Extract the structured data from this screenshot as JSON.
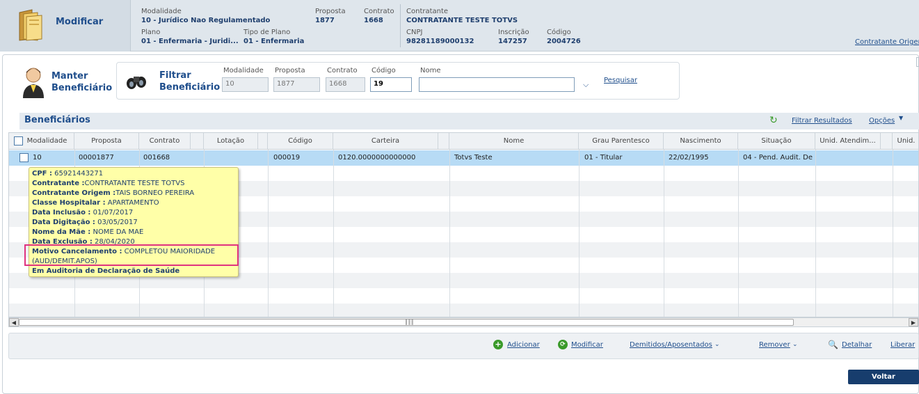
{
  "header": {
    "title": "Modificar",
    "modalidade_label": "Modalidade",
    "modalidade_value": "10 - Jurídico Nao Regulamentado",
    "proposta_label": "Proposta",
    "proposta_value": "1877",
    "contrato_label": "Contrato",
    "contrato_value": "1668",
    "plano_label": "Plano",
    "plano_value": "01 - Enfermaria - Juridi...",
    "tipo_plano_label": "Tipo de Plano",
    "tipo_plano_value": "01 - Enfermaria",
    "contratante_label": "Contratante",
    "contratante_value": "CONTRATANTE TESTE TOTVS",
    "cnpj_label": "CNPJ",
    "cnpj_value": "98281189000132",
    "inscricao_label": "Inscrição",
    "inscricao_value": "147257",
    "codigo_label": "Código",
    "codigo_value": "2004726",
    "contratante_origem_link": "Contratante Origem"
  },
  "manager": {
    "title_line1": "Manter",
    "title_line2": "Beneficiário"
  },
  "filter": {
    "title_line1": "Filtrar",
    "title_line2": "Beneficiário",
    "fields": {
      "modalidade": {
        "label": "Modalidade",
        "value": "10"
      },
      "proposta": {
        "label": "Proposta",
        "value": "1877"
      },
      "contrato": {
        "label": "Contrato",
        "value": "1668"
      },
      "codigo": {
        "label": "Código",
        "value": "19"
      },
      "nome": {
        "label": "Nome",
        "value": ""
      }
    },
    "search_link": "Pesquisar"
  },
  "section": {
    "title": "Beneficiários",
    "filter_results": "Filtrar Resultados",
    "options": "Opções"
  },
  "grid": {
    "columns": [
      "Modalidade",
      "Proposta",
      "Contrato",
      "Lotação",
      "Código",
      "Carteira",
      "Nome",
      "Grau Parentesco",
      "Nascimento",
      "Situação",
      "Unid. Atendim...",
      "Unid."
    ],
    "row": {
      "modalidade": "10",
      "proposta": "00001877",
      "contrato": "001668",
      "lotacao": "",
      "codigo": "000019",
      "carteira": "0120.0000000000000",
      "nome": "Totvs Teste",
      "grau": "01 - Titular",
      "nascimento": "22/02/1995",
      "situacao": "04 - Pend. Audit. De"
    }
  },
  "tooltip": {
    "cpf_label": "CPF :",
    "cpf_value": " 65921443271",
    "contratante_label": "Contratante :",
    "contratante_value": "CONTRATANTE TESTE TOTVS",
    "origem_label": "Contratante Origem :",
    "origem_value": "TAIS BORNEO PEREIRA",
    "classe_label": "Classe Hospitalar :",
    "classe_value": " APARTAMENTO",
    "inclusao_label": "Data Inclusão :",
    "inclusao_value": " 01/07/2017",
    "digitacao_label": "Data Digitação :",
    "digitacao_value": " 03/05/2017",
    "mae_label": "Nome da Mãe :",
    "mae_value": " NOME DA MAE",
    "exclusao_label": "Data Exclusão :",
    "exclusao_value": " 28/04/2020",
    "motivo_label": "Motivo Cancelamento :",
    "motivo_value": " COMPLETOU MAIORIDADE",
    "motivo_value2": "(AUD/DEMIT.APOS)",
    "auditoria": "Em Auditoria de Declaração de Saúde"
  },
  "actions": {
    "adicionar": "Adicionar",
    "modificar": "Modificar",
    "demitidos": "Demitidos/Aposentados",
    "remover": "Remover",
    "detalhar": "Detalhar",
    "liberar": "Liberar",
    "voltar": "Voltar"
  },
  "colors": {
    "accent": "#1f4e8c",
    "selected_row": "#b7dbf5",
    "tooltip_bg": "#ffffa8",
    "highlight": "#e0337f",
    "button_dark": "#173d6d"
  }
}
